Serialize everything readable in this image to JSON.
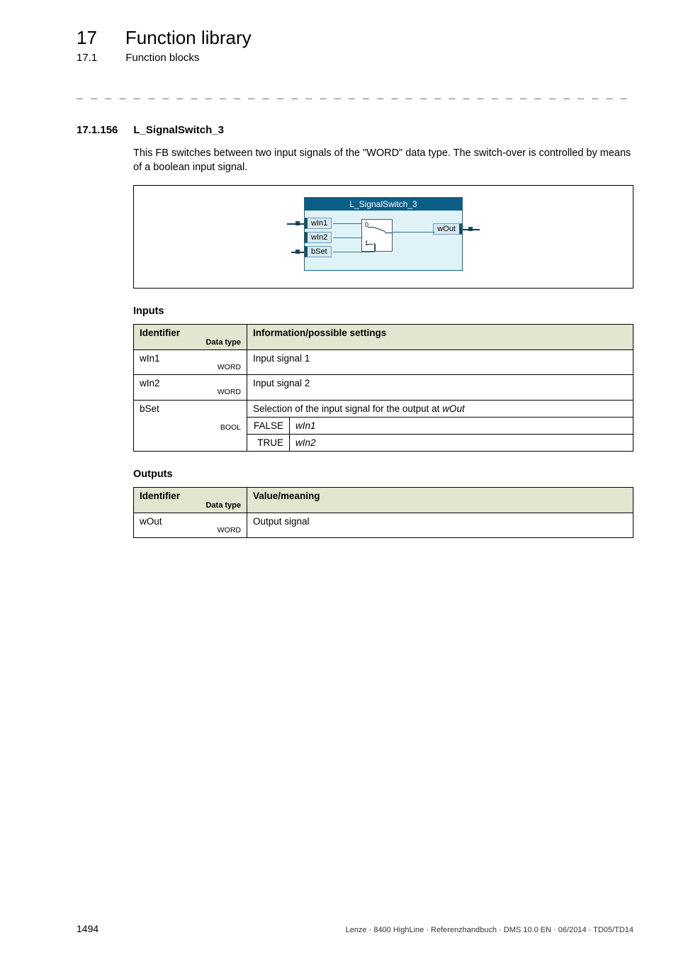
{
  "chapter": {
    "num": "17",
    "title": "Function library"
  },
  "section": {
    "num": "17.1",
    "title": "Function blocks"
  },
  "rule": "_ _ _ _ _ _ _ _ _ _ _ _ _ _ _ _ _ _ _ _ _ _ _ _ _ _ _ _ _ _ _ _ _ _ _ _ _ _ _ _ _ _ _ _ _ _ _ _ _ _ _ _ _ _ _ _ _ _ _ _ _ _ _ _",
  "fb": {
    "num": "17.1.156",
    "title": "L_SignalSwitch_3",
    "header": "L_SignalSwitch_3"
  },
  "desc": "This FB switches between two input signals of the \"WORD\" data type. The switch-over is controlled by means of a boolean input signal.",
  "ports": {
    "in1": "wIn1",
    "in2": "wIn2",
    "bset": "bSet",
    "out": "wOut",
    "s0": "0",
    "s1": "1"
  },
  "headings": {
    "inputs": "Inputs",
    "outputs": "Outputs"
  },
  "th": {
    "id": "Identifier",
    "dt": "Data type",
    "info": "Information/possible settings",
    "val": "Value/meaning"
  },
  "in": {
    "r1": {
      "id": "wIn1",
      "dt": "WORD",
      "info": "Input signal 1"
    },
    "r2": {
      "id": "wIn2",
      "dt": "WORD",
      "info": "Input signal 2"
    },
    "r3": {
      "id": "bSet",
      "dt": "BOOL",
      "info_pre": "Selection of the input signal for the output at ",
      "info_it": "wOut",
      "f": "FALSE",
      "fv": "wIn1",
      "t": "TRUE",
      "tv": "wIn2"
    }
  },
  "out": {
    "r1": {
      "id": "wOut",
      "dt": "WORD",
      "info": "Output signal"
    }
  },
  "footer": {
    "page": "1494",
    "right": "Lenze · 8400 HighLine · Referenzhandbuch · DMS 10.0 EN · 06/2014 · TD05/TD14"
  }
}
